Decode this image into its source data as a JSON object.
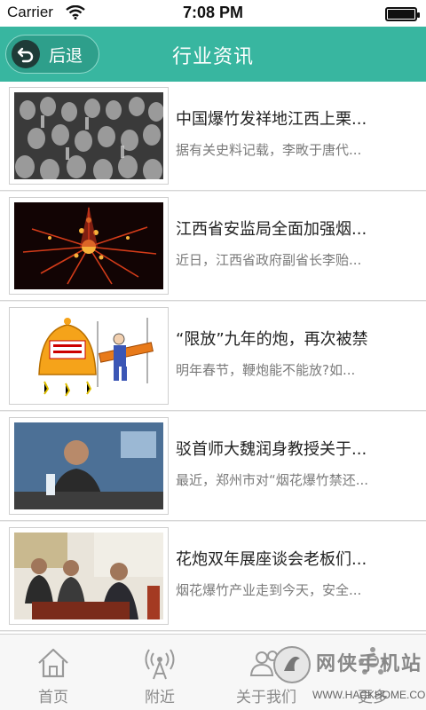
{
  "status_bar": {
    "carrier": "Carrier",
    "time": "7:08 PM"
  },
  "nav": {
    "back_label": "后退",
    "title": "行业资讯"
  },
  "news": [
    {
      "title": "中国爆竹发祥地江西上栗...",
      "summary": "据有关史料记载，李畋于唐代..."
    },
    {
      "title": "江西省安监局全面加强烟...",
      "summary": "近日，江西省政府副省长李贻..."
    },
    {
      "title": "“限放”九年的炮，再次被禁",
      "summary": "明年春节，鞭炮能不能放?如..."
    },
    {
      "title": "驳首师大魏润身教授关于...",
      "summary": "最近，郑州市对“烟花爆竹禁还..."
    },
    {
      "title": "花炮双年展座谈会老板们...",
      "summary": "烟花爆竹产业走到今天，安全..."
    }
  ],
  "tabs": [
    {
      "label": "首页",
      "icon": "home-icon"
    },
    {
      "label": "附近",
      "icon": "signal-tower-icon"
    },
    {
      "label": "关于我们",
      "icon": "people-icon"
    },
    {
      "label": "更多",
      "icon": "more-icon"
    }
  ],
  "watermark": {
    "text": "网侠手机站",
    "url": "WWW.HACKHOME.COM"
  }
}
